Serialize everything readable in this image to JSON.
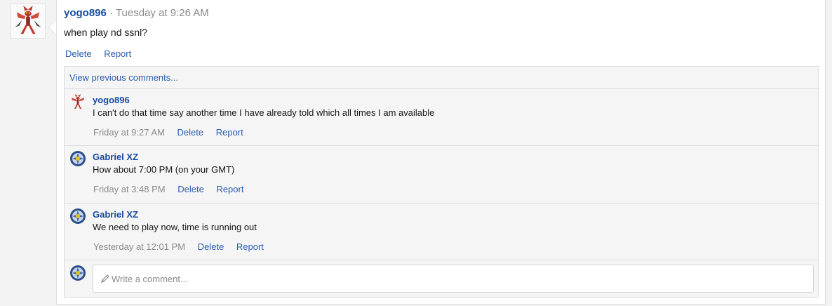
{
  "post": {
    "author": "yogo896",
    "separator": "·",
    "timestamp": "Tuesday at 9:26 AM",
    "body": "when play nd ssnl?",
    "actions": {
      "delete": "Delete",
      "report": "Report"
    }
  },
  "thread": {
    "view_previous": "View previous comments...",
    "comments": [
      {
        "author": "yogo896",
        "avatar": "red-insect-avatar",
        "text": "I can't do that time say another time I have already told which all times I am available",
        "timestamp": "Friday at 9:27 AM",
        "delete": "Delete",
        "report": "Report"
      },
      {
        "author": "Gabriel XZ",
        "avatar": "blue-yellow-emblem-avatar",
        "text": "How about 7:00 PM (on your GMT)",
        "timestamp": "Friday at 3:48 PM",
        "delete": "Delete",
        "report": "Report"
      },
      {
        "author": "Gabriel XZ",
        "avatar": "blue-yellow-emblem-avatar",
        "text": "We need to play now, time is running out",
        "timestamp": "Yesterday at 12:01 PM",
        "delete": "Delete",
        "report": "Report"
      }
    ],
    "composer": {
      "placeholder": "Write a comment...",
      "icon": "pencil-icon"
    }
  },
  "colors": {
    "link": "#2a5db0",
    "author": "#1a4aa0",
    "muted": "#8a8a8a",
    "thread_bg": "#f5f5f5"
  }
}
